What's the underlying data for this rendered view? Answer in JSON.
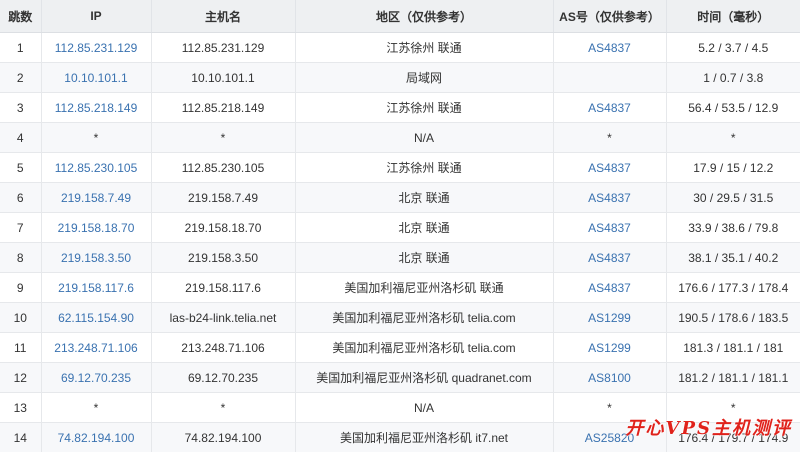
{
  "table": {
    "headers": {
      "hop": "跳数",
      "ip": "IP",
      "host": "主机名",
      "region": "地区（仅供参考）",
      "asn": "AS号（仅供参考）",
      "time": "时间（毫秒）"
    },
    "rows": [
      {
        "hop": "1",
        "ip": "112.85.231.129",
        "host": "112.85.231.129",
        "region": "江苏徐州 联通",
        "asn": "AS4837",
        "time": "5.2 / 3.7 / 4.5"
      },
      {
        "hop": "2",
        "ip": "10.10.101.1",
        "host": "10.10.101.1",
        "region": "局域网",
        "asn": "",
        "time": "1 / 0.7 / 3.8"
      },
      {
        "hop": "3",
        "ip": "112.85.218.149",
        "host": "112.85.218.149",
        "region": "江苏徐州 联通",
        "asn": "AS4837",
        "time": "56.4 / 53.5 / 12.9"
      },
      {
        "hop": "4",
        "ip": "*",
        "host": "*",
        "region": "N/A",
        "asn": "*",
        "time": "*"
      },
      {
        "hop": "5",
        "ip": "112.85.230.105",
        "host": "112.85.230.105",
        "region": "江苏徐州 联通",
        "asn": "AS4837",
        "time": "17.9 / 15 / 12.2"
      },
      {
        "hop": "6",
        "ip": "219.158.7.49",
        "host": "219.158.7.49",
        "region": "北京 联通",
        "asn": "AS4837",
        "time": "30 / 29.5 / 31.5"
      },
      {
        "hop": "7",
        "ip": "219.158.18.70",
        "host": "219.158.18.70",
        "region": "北京 联通",
        "asn": "AS4837",
        "time": "33.9 / 38.6 / 79.8"
      },
      {
        "hop": "8",
        "ip": "219.158.3.50",
        "host": "219.158.3.50",
        "region": "北京 联通",
        "asn": "AS4837",
        "time": "38.1 / 35.1 / 40.2"
      },
      {
        "hop": "9",
        "ip": "219.158.117.6",
        "host": "219.158.117.6",
        "region": "美国加利福尼亚州洛杉矶 联通",
        "asn": "AS4837",
        "time": "176.6 / 177.3 / 178.4"
      },
      {
        "hop": "10",
        "ip": "62.115.154.90",
        "host": "las-b24-link.telia.net",
        "region": "美国加利福尼亚州洛杉矶 telia.com",
        "asn": "AS1299",
        "time": "190.5 / 178.6 / 183.5"
      },
      {
        "hop": "11",
        "ip": "213.248.71.106",
        "host": "213.248.71.106",
        "region": "美国加利福尼亚州洛杉矶 telia.com",
        "asn": "AS1299",
        "time": "181.3 / 181.1 / 181"
      },
      {
        "hop": "12",
        "ip": "69.12.70.235",
        "host": "69.12.70.235",
        "region": "美国加利福尼亚州洛杉矶 quadranet.com",
        "asn": "AS8100",
        "time": "181.2 / 181.1 / 181.1"
      },
      {
        "hop": "13",
        "ip": "*",
        "host": "*",
        "region": "N/A",
        "asn": "*",
        "time": "*"
      },
      {
        "hop": "14",
        "ip": "74.82.194.100",
        "host": "74.82.194.100",
        "region": "美国加利福尼亚州洛杉矶 it7.net",
        "asn": "AS25820",
        "time": "176.4 / 179.7 / 174.9"
      }
    ]
  },
  "watermark": "开心VPS主机测评"
}
